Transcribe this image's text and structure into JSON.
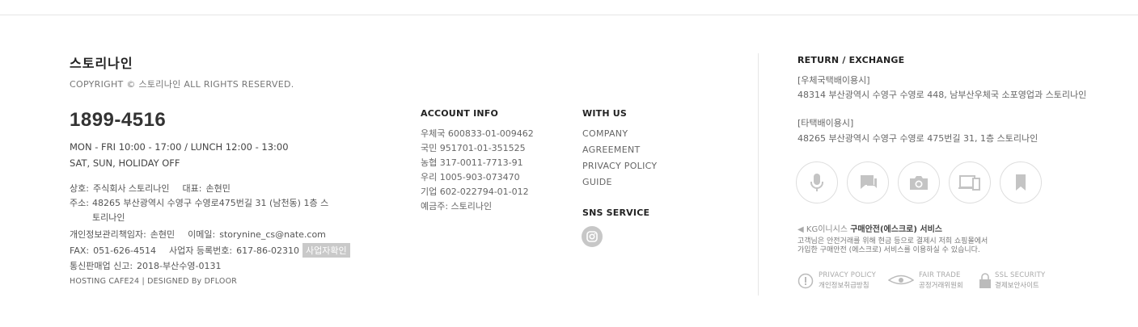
{
  "left": {
    "brand": "스토리나인",
    "copyright": "COPYRIGHT © 스토리나인 ALL RIGHTS RESERVED.",
    "phone": "1899-4516",
    "hours1": "MON - FRI 10:00 - 17:00 / LUNCH 12:00 - 13:00",
    "hours2": "SAT, SUN, HOLIDAY OFF",
    "company_label": "상호:",
    "company_value": "주식회사 스토리나인",
    "ceo_label": "대표:",
    "ceo_value": "손현민",
    "address_label": "주소:",
    "address_value": "48265 부산광역시 수영구 수영로475번길 31 (남천동) 1층 스토리나인",
    "privacy_label": "개인정보관리책임자:",
    "privacy_value": "손현민",
    "email_label": "이메일:",
    "email_value": "storynine_cs@nate.com",
    "fax_label": "FAX:",
    "fax_value": "051-626-4514",
    "bizno_label": "사업자 등록번호:",
    "bizno_value": "617-86-02310",
    "bizcheck_button": "사업자확인",
    "mailorder_label": "통신판매업 신고:",
    "mailorder_value": "2018-부산수영-0131",
    "hosting": "HOSTING CAFE24  |  DESIGNED By DFLOOR"
  },
  "account": {
    "title": "ACCOUNT INFO",
    "lines": [
      "우체국 600833-01-009462",
      "국민 951701-01-351525",
      "농협 317-0011-7713-91",
      "우리 1005-903-073470",
      "기업 602-022794-01-012",
      "예금주: 스토리나인"
    ]
  },
  "withus": {
    "title": "WITH US",
    "links": [
      "COMPANY",
      "AGREEMENT",
      "PRIVACY POLICY",
      "GUIDE"
    ],
    "sns_title": "SNS SERVICE",
    "sns_icon": "instagram-icon"
  },
  "return": {
    "title": "RETURN / EXCHANGE",
    "post_label": "[우체국택배이용시]",
    "post_addr": "48314 부산광역시 수영구 수영로 448, 남부산우체국 소포영업과 스토리나인",
    "other_label": "[타택배이용시]",
    "other_addr": "48265 부산광역시 수영구 수영로 475번길 31, 1층 스토리나인",
    "icons": [
      "microphone-icon",
      "chat-icon",
      "camera-icon",
      "devices-icon",
      "bookmark-icon"
    ],
    "kg_brand": "KG이니시스",
    "kg_service": "구매안전(에스크로) 서비스",
    "kg_desc1": "고객님은 안전거래를 위해 현금 등으로 결제시 저희 쇼핑몰에서",
    "kg_desc2": "가입한 구매안전 (에스크로) 서비스를 이용하실 수 있습니다.",
    "badges": [
      {
        "en": "PRIVACY POLICY",
        "ko": "개인정보취급방침",
        "icon": "privacy-badge-icon"
      },
      {
        "en": "FAIR TRADE",
        "ko": "공정거래위원회",
        "icon": "fair-trade-icon"
      },
      {
        "en": "SSL SECURITY",
        "ko": "결제보안사이트",
        "icon": "lock-icon"
      }
    ]
  },
  "colors": {
    "text": "#555555",
    "title": "#222222",
    "muted_gray": "#c9c9c9",
    "divider": "#e6e6e6"
  }
}
